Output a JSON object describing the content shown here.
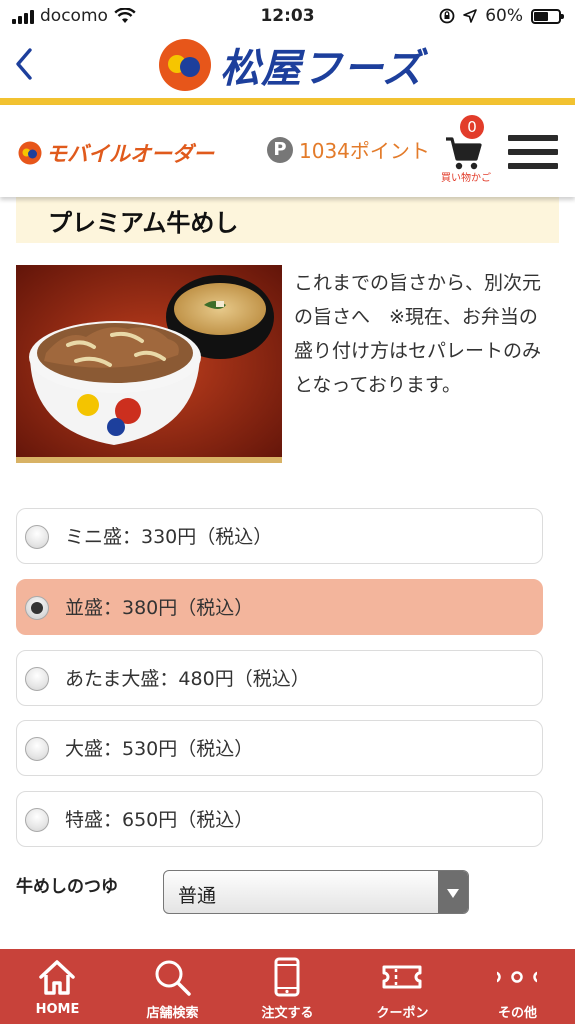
{
  "status_bar": {
    "carrier": "docomo",
    "time": "12:03",
    "battery": "60%",
    "battery_level": 0.6
  },
  "header": {
    "logo_text": "松屋フーズ"
  },
  "order_bar": {
    "brand": "モバイルオーダー",
    "points": "1034ポイント",
    "points_icon": "P",
    "cart_count": "0",
    "cart_label": "買い物かご"
  },
  "product": {
    "title": "プレミアム牛めし",
    "description": "これまでの旨さから、別次元の旨さへ　※現在、お弁当の盛り付け方はセパレートのみとなっております。"
  },
  "options": [
    {
      "label": "ミニ盛：330円（税込）",
      "selected": false
    },
    {
      "label": "並盛：380円（税込）",
      "selected": true
    },
    {
      "label": "あたま大盛：480円（税込）",
      "selected": false
    },
    {
      "label": "大盛：530円（税込）",
      "selected": false
    },
    {
      "label": "特盛：650円（税込）",
      "selected": false
    }
  ],
  "tsuyu": {
    "label": "牛めしのつゆ",
    "value": "普通"
  },
  "tabs": [
    {
      "label": "HOME",
      "icon": "home-icon"
    },
    {
      "label": "店舗検索",
      "icon": "search-icon"
    },
    {
      "label": "注文する",
      "icon": "phone-icon"
    },
    {
      "label": "クーポン",
      "icon": "ticket-icon"
    },
    {
      "label": "その他",
      "icon": "more-icon"
    }
  ],
  "colors": {
    "brand_blue": "#1d3f9c",
    "brand_orange": "#e05a1c",
    "accent_yellow": "#f2c230",
    "selected_option": "#f3b59c",
    "tab_bar": "#c8423a"
  }
}
